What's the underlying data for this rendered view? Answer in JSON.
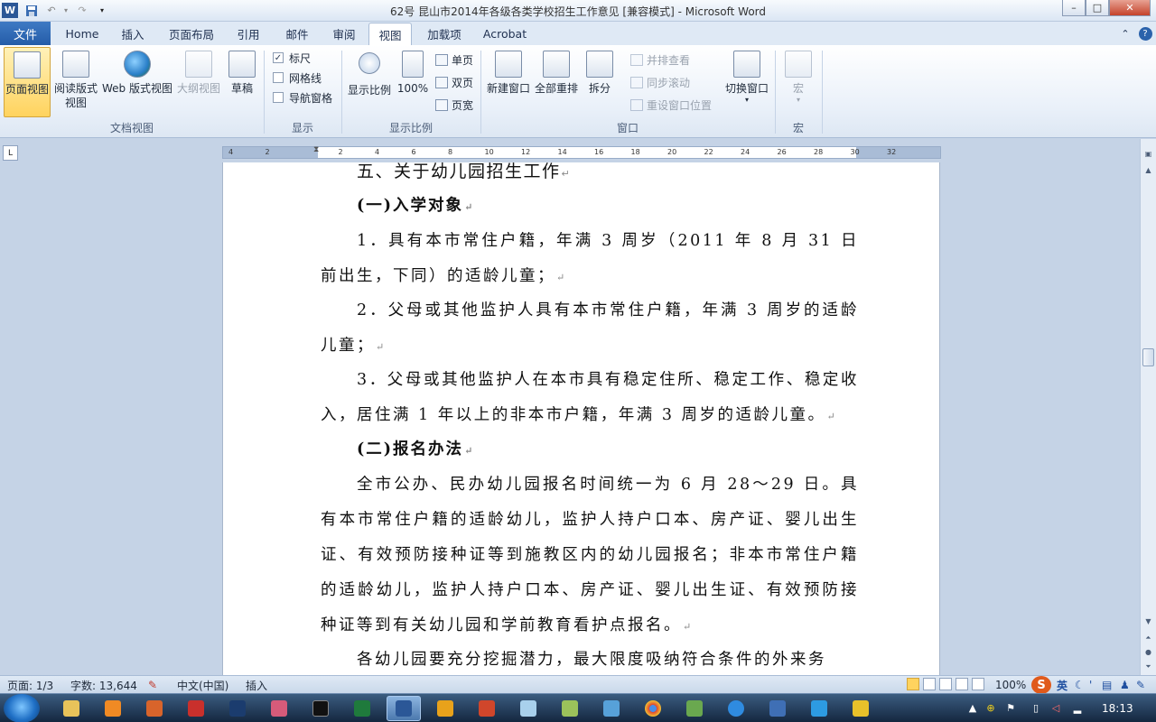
{
  "window": {
    "title": "62号 昆山市2014年各级各类学校招生工作意见 [兼容模式] - Microsoft Word",
    "controls": {
      "minimize": "–",
      "maximize": "□",
      "close": "✕"
    }
  },
  "tabs": {
    "file": "文件",
    "items": [
      {
        "label": "Home"
      },
      {
        "label": "插入"
      },
      {
        "label": "页面布局"
      },
      {
        "label": "引用"
      },
      {
        "label": "邮件"
      },
      {
        "label": "审阅"
      },
      {
        "label": "视图"
      },
      {
        "label": "加载项"
      },
      {
        "label": "Acrobat"
      }
    ],
    "active": "视图"
  },
  "ribbon": {
    "doc_views": {
      "label": "文档视图",
      "print_layout": "页面视图",
      "reading_line1": "阅读版式",
      "reading_line2": "视图",
      "web_layout": "Web 版式视图",
      "outline": "大纲视图",
      "draft": "草稿"
    },
    "show": {
      "label": "显示",
      "ruler": "标尺",
      "gridlines": "网格线",
      "nav_pane": "导航窗格",
      "ruler_checked": true,
      "gridlines_checked": false,
      "nav_pane_checked": false
    },
    "zoom": {
      "label": "显示比例",
      "zoom": "显示比例",
      "hundred": "100%",
      "one_page": "单页",
      "two_pages": "双页",
      "page_width": "页宽"
    },
    "window": {
      "label": "窗口",
      "new_window": "新建窗口",
      "arrange_all": "全部重排",
      "split": "拆分",
      "side_by_side": "并排查看",
      "sync_scroll": "同步滚动",
      "reset_position": "重设窗口位置",
      "switch_windows": "切换窗口"
    },
    "macros": {
      "label": "宏",
      "macros": "宏"
    }
  },
  "ruler": {
    "ticks": [
      "4",
      "2",
      "",
      "2",
      "4",
      "6",
      "8",
      "10",
      "12",
      "14",
      "16",
      "18",
      "20",
      "22",
      "24",
      "26",
      "28",
      "30",
      "32"
    ]
  },
  "document": {
    "heading": "五、关于幼儿园招生工作",
    "sub1": "(一)入学对象",
    "p1": "1．具有本市常住户籍，年满 3 周岁（2011 年 8 月 31 日前出生，下同）的适龄儿童；",
    "p2": "2．父母或其他监护人具有本市常住户籍，年满 3 周岁的适龄儿童；",
    "p3": "3．父母或其他监护人在本市具有稳定住所、稳定工作、稳定收入，居住满 1 年以上的非本市户籍，年满 3 周岁的适龄儿童。",
    "sub2": "(二)报名办法",
    "p4": "全市公办、民办幼儿园报名时间统一为 6 月 28～29 日。具有本市常住户籍的适龄幼儿，监护人持户口本、房产证、婴儿出生证、有效预防接种证等到施教区内的幼儿园报名；非本市常住户籍的适龄幼儿，监护人持户口本、房产证、婴儿出生证、有效预防接种证等到有关幼儿园和学前教育看护点报名。",
    "p5": "各幼儿园要充分挖掘潜力，最大限度吸纳符合条件的外来务",
    "para_mark": "↵"
  },
  "status": {
    "page": "页面: 1/3",
    "words": "字数: 13,644",
    "language": "中文(中国)",
    "mode": "插入",
    "zoom": "100%",
    "zoom_level": 1.0
  },
  "ime": {
    "lang": "英"
  },
  "taskbar": {
    "time": "18:13"
  },
  "colors": {
    "file_tab": "#2b62ab",
    "selected_button": "#ffd35e",
    "workspace": "#c5d3e6",
    "taskbar": "#1d3552"
  }
}
